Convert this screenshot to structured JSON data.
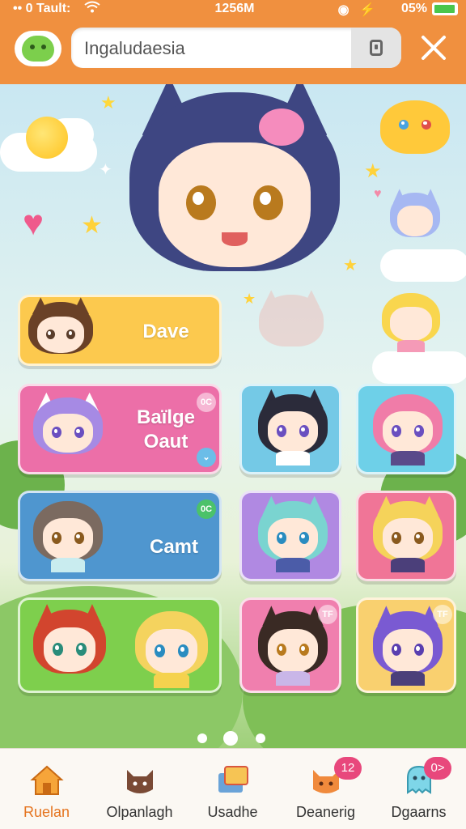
{
  "status_bar": {
    "left_text": "•• 0 Tault:",
    "time": "1256M",
    "battery_percent_text": "05%",
    "battery_level": 0.95,
    "icons": [
      "wifi-icon",
      "alarm-icon",
      "bluetooth-icon",
      "battery-icon"
    ]
  },
  "header": {
    "logo_icon": "green-blob-logo-icon",
    "search": {
      "value": "Ingaludaesia",
      "button_icon": "lock-icon"
    },
    "close_icon": "close-icon",
    "color": "#f0903f"
  },
  "cards": {
    "dave": {
      "label": "Dave",
      "color": "#fcc94e"
    },
    "baigle": {
      "label_line1": "Baïlge",
      "label_line2": "Oaut",
      "badge": "0C",
      "color": "#ec6fa8"
    },
    "camt": {
      "label": "Camt",
      "badge": "0C",
      "color": "#4f96cf"
    },
    "friends": {
      "color": "#7ecf4d"
    },
    "tiles": [
      {
        "badge": "",
        "color": "#74c9e6"
      },
      {
        "badge": "",
        "color": "#6ed0e8"
      },
      {
        "badge": "",
        "color": "#b089e2"
      },
      {
        "badge": "",
        "color": "#f07597"
      },
      {
        "badge": "TF",
        "color": "#f07fae"
      },
      {
        "badge": "TF",
        "color": "#f9d06f"
      }
    ]
  },
  "pager": {
    "pages": 3,
    "active": 2
  },
  "bottom_nav": [
    {
      "label": "Ruelan",
      "icon": "house-icon",
      "badge": "",
      "active": true
    },
    {
      "label": "Olpanlagh",
      "icon": "cat-face-icon",
      "badge": "",
      "active": false
    },
    {
      "label": "Usadhe",
      "icon": "photo-stack-icon",
      "badge": "",
      "active": false
    },
    {
      "label": "Deanerig",
      "icon": "cat-head-icon",
      "badge": "12",
      "active": false
    },
    {
      "label": "Dgaarns",
      "icon": "ghost-icon",
      "badge": "0>",
      "active": false
    }
  ]
}
